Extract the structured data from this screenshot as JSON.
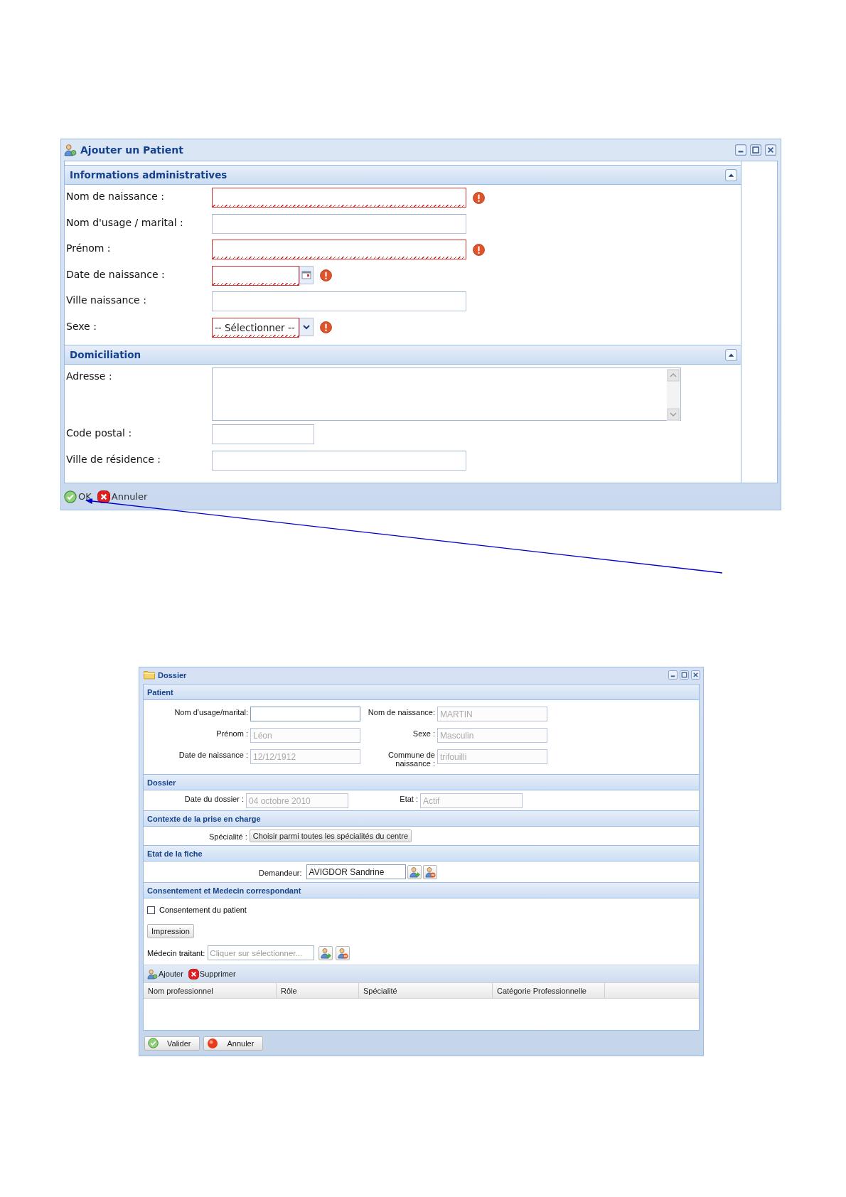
{
  "add_patient_window": {
    "title": "Ajouter un Patient",
    "sections": [
      {
        "title": "Informations administratives",
        "fields": [
          {
            "label": "Nom de naissance :",
            "kind": "text",
            "invalid": true
          },
          {
            "label": "Nom d'usage / marital :",
            "kind": "text",
            "invalid": false
          },
          {
            "label": "Prénom :",
            "kind": "text",
            "invalid": true
          },
          {
            "label": "Date de naissance :",
            "kind": "date",
            "invalid": true
          },
          {
            "label": "Ville naissance :",
            "kind": "text",
            "invalid": false
          },
          {
            "label": "Sexe :",
            "kind": "select",
            "value": "-- Sélectionner --",
            "invalid": true
          }
        ]
      },
      {
        "title": "Domiciliation",
        "fields": [
          {
            "label": "Adresse :",
            "kind": "textarea",
            "invalid": false
          },
          {
            "label": "Code postal :",
            "kind": "short",
            "invalid": false
          },
          {
            "label": "Ville de résidence :",
            "kind": "text",
            "invalid": false
          }
        ]
      }
    ],
    "buttons": [
      {
        "label": "OK",
        "kind": "ok"
      },
      {
        "label": "Annuler",
        "kind": "cancel"
      }
    ]
  },
  "dossier_window": {
    "title": "Dossier",
    "patient": {
      "title": "Patient",
      "fields": [
        {
          "label": "Nom d'usage/marital:",
          "disabled": false
        },
        {
          "label": "Nom de naissance:",
          "value": "MARTIN",
          "disabled": true
        },
        {
          "label": "Prénom :",
          "value": "Léon",
          "disabled": true
        },
        {
          "label": "Sexe :",
          "value": "Masculin",
          "disabled": true
        },
        {
          "label": "Date de naissance :",
          "value": "12/12/1912",
          "disabled": true
        },
        {
          "label": "Commune de naissance :",
          "value": "trifouilli",
          "disabled": true
        }
      ]
    },
    "dossier": {
      "title": "Dossier",
      "fields": [
        {
          "label": "Date du dossier :",
          "value": "04 octobre 2010",
          "disabled": true
        },
        {
          "label": "Etat :",
          "value": "Actif",
          "disabled": true
        }
      ]
    },
    "context": {
      "title": "Contexte de la prise en charge",
      "label": "Spécialité :",
      "button": "Choisir parmi toutes les spécialités du centre"
    },
    "sheet_state": {
      "title": "Etat de la fiche",
      "label": "Demandeur:",
      "value": "AVIGDOR Sandrine"
    },
    "consent": {
      "title": "Consentement et Medecin correspondant",
      "checkbox": {
        "label": "Consentement du patient",
        "checked": false
      },
      "print_button": "Impression",
      "doctor": {
        "label": "Médecin traitant:",
        "placeholder": "Cliquer sur sélectionner..."
      },
      "toolbar": [
        {
          "label": "Ajouter",
          "kind": "add"
        },
        {
          "label": "Supprimer",
          "kind": "delete"
        }
      ],
      "columns": [
        "Nom professionnel",
        "Rôle",
        "Spécialité",
        "Catégorie Professionnelle"
      ]
    },
    "buttons": [
      {
        "label": "Valider",
        "kind": "ok"
      },
      {
        "label": "Annuler",
        "kind": "cancel"
      }
    ]
  }
}
